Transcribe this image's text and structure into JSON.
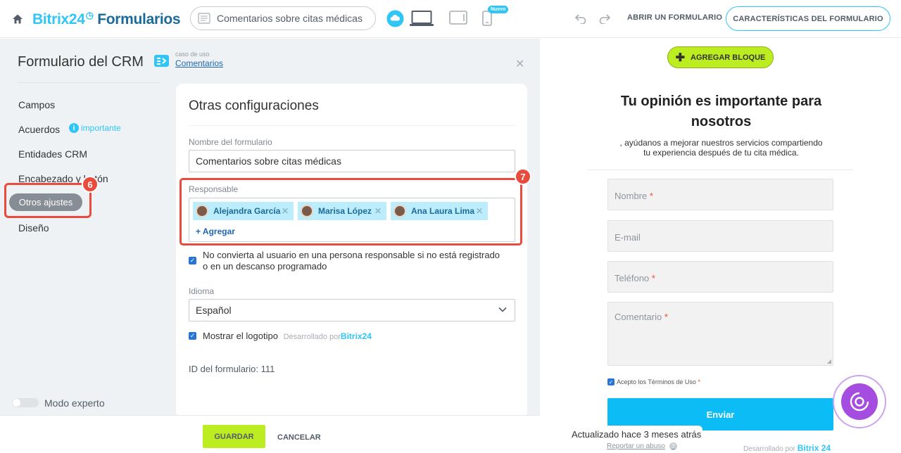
{
  "topbar": {
    "logo_brand": "Bitrix24",
    "logo_product": "Formularios",
    "form_title": "Comentarios sobre citas médicas",
    "new_badge": "Nuevo",
    "open_form": "ABRIR UN FORMULARIO",
    "form_features": "CARACTERÍSTICAS DEL FORMULARIO"
  },
  "sidebar": {
    "title": "Formulario del CRM",
    "usecase_small": "caso de uso",
    "usecase_link": "Comentarios",
    "items": [
      {
        "label": "Campos"
      },
      {
        "label": "Acuerdos"
      },
      {
        "label": "Entidades CRM"
      },
      {
        "label": "Encabezado y botón"
      },
      {
        "label": "Otros ajustes"
      },
      {
        "label": "Diseño"
      }
    ],
    "important": "importante",
    "expert_mode": "Modo experto",
    "badge_6": "6"
  },
  "settings": {
    "title": "Otras configuraciones",
    "name_label": "Nombre del formulario",
    "name_value": "Comentarios sobre citas médicas",
    "responsible_label": "Responsable",
    "badge_7": "7",
    "responsibles": [
      {
        "name": "Alejandra García"
      },
      {
        "name": "Marisa López"
      },
      {
        "name": "Ana Laura Lima"
      }
    ],
    "add": "+ Agregar",
    "no_convert_line1": "No convierta al usuario en una persona responsable si no está registrado",
    "no_convert_line2": "o en un descanso programado",
    "language_label": "Idioma",
    "language_value": "Español",
    "show_logo": "Mostrar el logotipo",
    "developed_by": "Desarrollado por",
    "developed_brand": "Bitrix24",
    "form_id": "ID del formulario: 111"
  },
  "footer": {
    "save": "GUARDAR",
    "cancel": "CANCELAR"
  },
  "preview": {
    "add_block": "AGREGAR BLOQUE",
    "title_line1": "Tu opinión es importante para",
    "title_line2": "nosotros",
    "subtitle_line1": ", ayúdanos a mejorar nuestros servicios compartiendo",
    "subtitle_line2": "tu experiencia después de tu cita médica.",
    "fields": [
      {
        "label": "Nombre",
        "required": "*"
      },
      {
        "label": "E-mail",
        "required": ""
      },
      {
        "label": "Teléfono",
        "required": "*"
      },
      {
        "label": "Comentario",
        "required": "*"
      }
    ],
    "terms": "Acepto los Términos de Uso",
    "terms_required": "*",
    "submit": "Enviar",
    "updated": "Actualizado hace 3 meses atrás",
    "report_abuse": "Reportar un abuso",
    "developed_by": "Desarrollado por",
    "developed_brand": "Bitrix 24"
  },
  "colors": {
    "accent": "#2fc6f6",
    "highlight": "#e94b3c",
    "save_green": "#bbed21",
    "submit_blue": "#0bbdf4",
    "assistant_purple": "#a54de0"
  }
}
